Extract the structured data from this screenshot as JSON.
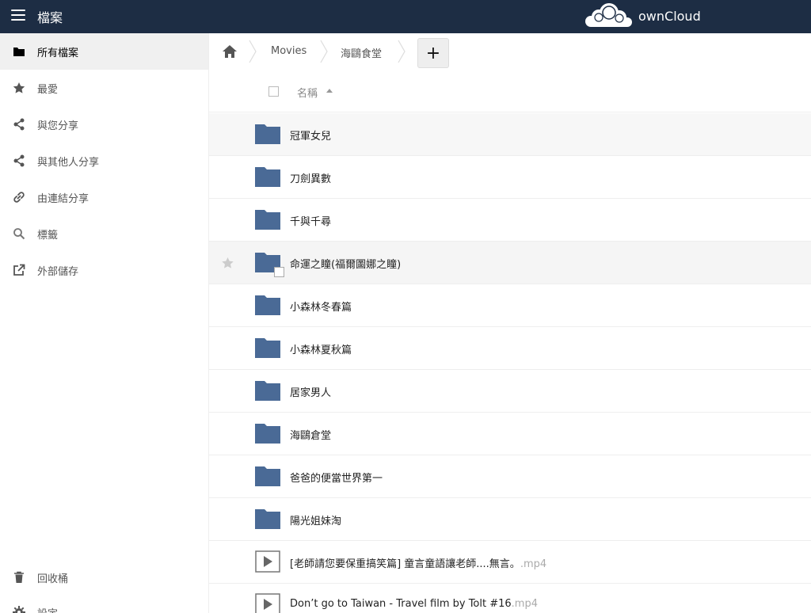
{
  "header": {
    "app_title": "檔案",
    "brand_name": "ownCloud",
    "bg_color": "#1d2d44"
  },
  "sidebar": {
    "items": [
      {
        "label": "所有檔案",
        "icon": "folder-icon",
        "active": true
      },
      {
        "label": "最愛",
        "icon": "star-icon"
      },
      {
        "label": "與您分享",
        "icon": "share-icon"
      },
      {
        "label": "與其他人分享",
        "icon": "share-icon"
      },
      {
        "label": "由連結分享",
        "icon": "link-icon"
      },
      {
        "label": "標籤",
        "icon": "search-icon"
      },
      {
        "label": "外部儲存",
        "icon": "external-link-icon"
      }
    ],
    "bottom_items": [
      {
        "label": "回收桶",
        "icon": "trash-icon"
      },
      {
        "label": "設定",
        "icon": "gear-icon"
      }
    ]
  },
  "breadcrumb": {
    "items": [
      "Movies",
      "海鷗食堂"
    ],
    "new_button": "+"
  },
  "table": {
    "header_name": "名稱",
    "sort": "ascending"
  },
  "files": [
    {
      "name": "冠軍女兒",
      "ext": "",
      "type": "folder"
    },
    {
      "name": "刀劍異數",
      "ext": "",
      "type": "folder"
    },
    {
      "name": "千與千尋",
      "ext": "",
      "type": "folder"
    },
    {
      "name": "命運之瞳(福爾圖娜之瞳)",
      "ext": "",
      "type": "folder"
    },
    {
      "name": "小森林冬春篇",
      "ext": "",
      "type": "folder"
    },
    {
      "name": "小森林夏秋篇",
      "ext": "",
      "type": "folder"
    },
    {
      "name": "居家男人",
      "ext": "",
      "type": "folder"
    },
    {
      "name": "海鷗倉堂",
      "ext": "",
      "type": "folder"
    },
    {
      "name": "爸爸的便當世界第一",
      "ext": "",
      "type": "folder"
    },
    {
      "name": "陽光姐妹淘",
      "ext": "",
      "type": "folder"
    },
    {
      "name": "[老師請您要保重搞笑篇] 童言童語讓老師....無言。",
      "ext": ".mp4",
      "type": "video"
    },
    {
      "name": "Don’t go to Taiwan - Travel film by Tolt #16",
      "ext": ".mp4",
      "type": "video"
    }
  ],
  "colors": {
    "folder": "#4a6a96",
    "accent": "#1d2d44"
  }
}
